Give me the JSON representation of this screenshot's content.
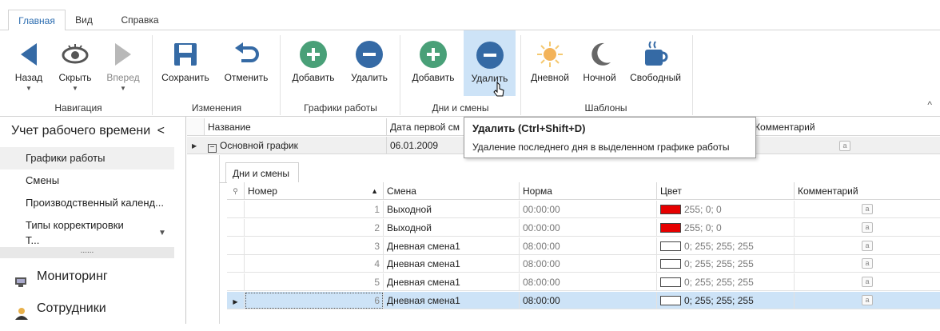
{
  "tabs": [
    "Главная",
    "Вид",
    "Справка"
  ],
  "ribbon": {
    "groups": {
      "navigation": "Навигация",
      "changes": "Изменения",
      "schedules": "Графики работы",
      "days": "Дни и смены",
      "templates": "Шаблоны"
    },
    "buttons": {
      "back": "Назад",
      "hide": "Скрыть",
      "forward": "Вперед",
      "save": "Сохранить",
      "undo": "Отменить",
      "sched_add": "Добавить",
      "sched_delete": "Удалить",
      "day_add": "Добавить",
      "day_delete": "Удалить",
      "day_tpl": "Дневной",
      "night_tpl": "Ночной",
      "free_tpl": "Свободный"
    }
  },
  "left_panel": {
    "title": "Учет рабочего времени",
    "items": [
      "Графики работы",
      "Смены",
      "Производственный календ...",
      "Типы корректировки",
      "Т..."
    ],
    "splitter": "......",
    "monitoring": "Мониторинг",
    "employees": "Сотрудники"
  },
  "tooltip": {
    "title": "Удалить (Ctrl+Shift+D)",
    "description": "Удаление последнего дня в выделенном графике работы"
  },
  "master_grid": {
    "columns": {
      "name": "Название",
      "first_day": "Дата первой см",
      "comment": "Комментарий"
    },
    "row": {
      "name": "Основной график",
      "first_day": "06.01.2009"
    }
  },
  "detail": {
    "tab": "Дни и смены",
    "columns": {
      "number": "Номер",
      "shift": "Смена",
      "norm": "Норма",
      "color": "Цвет",
      "comment": "Комментарий"
    },
    "rows": [
      {
        "number": "1",
        "shift": "Выходной",
        "norm": "00:00:00",
        "color": "255; 0; 0",
        "swatch": "#e60000"
      },
      {
        "number": "2",
        "shift": "Выходной",
        "norm": "00:00:00",
        "color": "255; 0; 0",
        "swatch": "#e60000"
      },
      {
        "number": "3",
        "shift": "Дневная смена1",
        "norm": "08:00:00",
        "color": "0; 255; 255; 255",
        "swatch": "#ffffff"
      },
      {
        "number": "4",
        "shift": "Дневная смена1",
        "norm": "08:00:00",
        "color": "0; 255; 255; 255",
        "swatch": "#ffffff"
      },
      {
        "number": "5",
        "shift": "Дневная смена1",
        "norm": "08:00:00",
        "color": "0; 255; 255; 255",
        "swatch": "#ffffff"
      },
      {
        "number": "6",
        "shift": "Дневная смена1",
        "norm": "08:00:00",
        "color": "0; 255; 255; 255",
        "swatch": "#ffffff"
      }
    ],
    "note_glyph": "a"
  },
  "colors": {
    "accent": "#2b6cb0",
    "green": "#49a078",
    "blue": "#356aa5",
    "selected_row": "#cde3f7"
  }
}
